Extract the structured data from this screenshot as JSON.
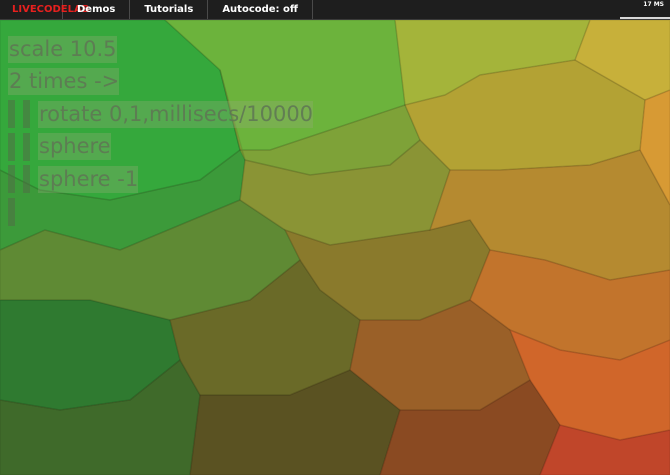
{
  "menu": {
    "brand": "LIVECODELAB",
    "items": [
      "Demos",
      "Tutorials",
      "Autocode: off"
    ]
  },
  "stats": {
    "fps_label": "17 MS"
  },
  "editor": {
    "lines": [
      {
        "indent": 0,
        "text": "scale 10.5"
      },
      {
        "indent": 0,
        "text": "2 times ->"
      },
      {
        "indent": 1,
        "text": "rotate 0,1,millisecs/10000"
      },
      {
        "indent": 1,
        "text": "sphere"
      },
      {
        "indent": 1,
        "text": "sphere -1"
      },
      {
        "indent": 1,
        "text": ""
      }
    ]
  },
  "colors": {
    "brand": "#e8201e",
    "topbar_bg": "#1e1e1e",
    "menu_text": "#ffffff",
    "code_text": "#5f7654",
    "scene_green": "#2a9a35",
    "scene_yellow": "#b8b23a",
    "scene_orange": "#d8702a",
    "scene_brown": "#5a4a20"
  }
}
